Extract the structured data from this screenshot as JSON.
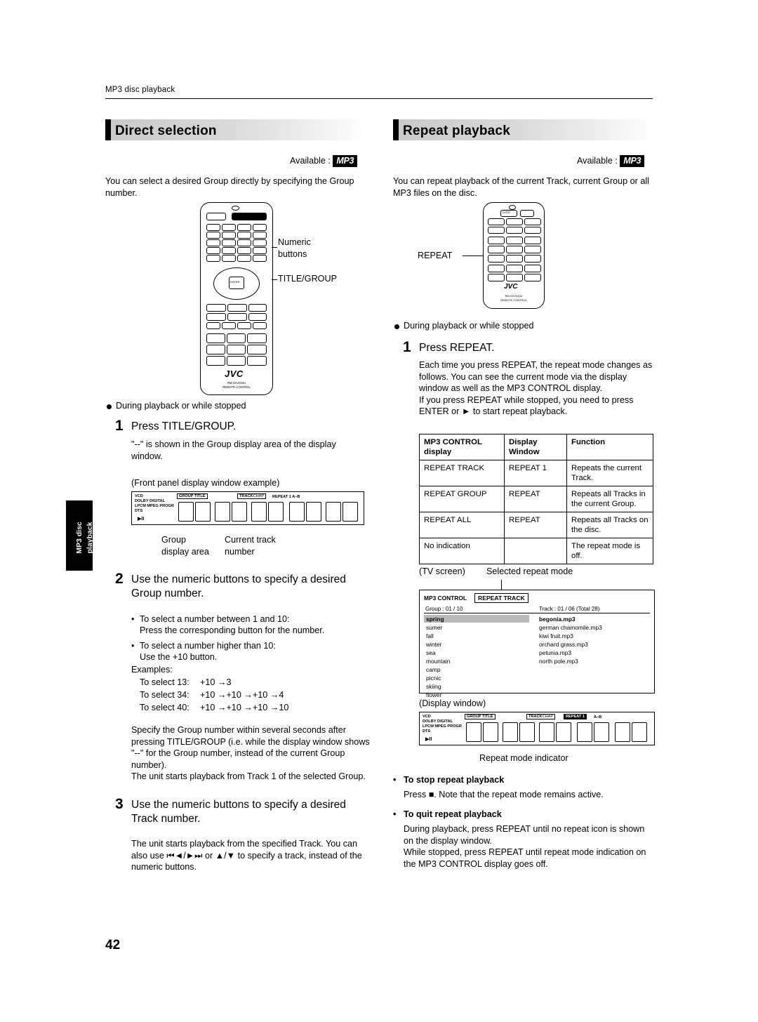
{
  "header": {
    "running_head": "MP3 disc playback"
  },
  "page_number": "42",
  "side_tab": {
    "line1": "MP3 disc",
    "line2": "playback"
  },
  "left": {
    "section_title": "Direct selection",
    "available_label": "Available :",
    "available_badge": "MP3",
    "intro": "You can select a desired Group directly by specifying the Group number.",
    "callouts": {
      "numeric_buttons": "Numeric\nbuttons",
      "title_group": "TITLE/GROUP"
    },
    "bullet_during": "During playback or while stopped",
    "step1_num": "1",
    "step1_text": "Press TITLE/GROUP.",
    "step1_body": "\"--\" is shown in the Group display area of the display window.",
    "front_panel_caption": "(Front panel display window example)",
    "fpd_labels": {
      "vcd": "VCD",
      "cd": "CD",
      "dolby": "DOLBY DIGITAL",
      "lpcm": "LPCM  MPEG  PROGR",
      "dts": "DTS",
      "group_title": "GROUP TITLE",
      "track": "TRACK",
      "chap": "CHAP",
      "repeat": "REPEAT 1 A–B"
    },
    "fpd_caption_left": "Group\ndisplay area",
    "fpd_caption_right": "Current track\nnumber",
    "step2_num": "2",
    "step2_text": "Use the numeric buttons to specify a desired Group number.",
    "step2_bullets": [
      "To select a number between 1 and 10:",
      "To select a number higher than 10:"
    ],
    "step2_sub": [
      "Press the corresponding button for the number.",
      "Use the +10 button."
    ],
    "examples_label": "Examples:",
    "examples": [
      {
        "label": "To select 13:",
        "value": "+10 →3"
      },
      {
        "label": "To select 34:",
        "value": "+10 →+10 →+10 →4"
      },
      {
        "label": "To select 40:",
        "value": "+10 →+10 →+10 →10"
      }
    ],
    "step2_note": "Specify the Group number within several seconds after pressing TITLE/GROUP (i.e. while the display window shows \"--\" for the Group number, instead of the current Group number).\nThe unit starts playback from Track 1 of the selected Group.",
    "step3_num": "3",
    "step3_text": "Use the numeric buttons to specify a desired Track number.",
    "step3_body": "The unit starts playback from the specified Track. You can also use ⏮◄/►⏭ or ▲/▼ to specify a track, instead of the numeric buttons."
  },
  "right": {
    "section_title": "Repeat playback",
    "available_label": "Available :",
    "available_badge": "MP3",
    "intro": "You can repeat playback of the current Track, current Group or all MP3 files on the disc.",
    "callout_repeat": "REPEAT",
    "bullet_during": "During playback or while stopped",
    "step1_num": "1",
    "step1_text": "Press REPEAT.",
    "step1_body": "Each time you press REPEAT, the repeat mode changes as follows. You can see the current mode via the display window as well as the MP3 CONTROL display.\nIf you press REPEAT while stopped, you need to press ENTER or ► to start repeat playback.",
    "table": {
      "headers": [
        "MP3 CONTROL display",
        "Display Window",
        "Function"
      ],
      "rows": [
        [
          "REPEAT TRACK",
          "REPEAT 1",
          "Repeats the current Track."
        ],
        [
          "REPEAT GROUP",
          "REPEAT",
          "Repeats all Tracks in the current Group."
        ],
        [
          "REPEAT ALL",
          "REPEAT",
          "Repeats all Tracks on the disc."
        ],
        [
          "No indication",
          "",
          "The repeat mode is off."
        ]
      ]
    },
    "tv_caption": "(TV screen)",
    "tv_callout": "Selected repeat mode",
    "tv": {
      "title": "MP3 CONTROL",
      "mode_tag": "REPEAT TRACK",
      "group_info": "Group : 01 / 10",
      "track_info": "Track : 01 / 06 (Total 28)",
      "left_list": [
        "spring",
        "sumer",
        "fall",
        "winter",
        "sea",
        "mountain",
        "camp",
        "picnic",
        "skiing",
        "flower"
      ],
      "right_list": [
        "begonia.mp3",
        "german chamomile.mp3",
        "kiwi fruit.mp3",
        "orchard grass.mp3",
        "petunia.mp3",
        "north pole.mp3"
      ]
    },
    "display_window_caption": "(Display window)",
    "fpd_labels": {
      "vcd": "VCD",
      "cd": "CD",
      "dolby": "DOLBY DIGITAL",
      "lpcm": "LPCM  MPEG  PROGR",
      "dts": "DTS",
      "group_title": "GROUP TITLE",
      "track": "TRACK",
      "chap": "CHAP",
      "repeat": "REPEAT 1 A–B"
    },
    "repeat_indicator_caption": "Repeat mode indicator",
    "stop_heading": "To stop repeat playback",
    "stop_body": "Press ■. Note that the repeat mode remains active.",
    "quit_heading": "To quit repeat playback",
    "quit_body": "During playback, press REPEAT until no repeat icon is shown on the display window.\nWhile stopped, press REPEAT until repeat mode indication on the MP3 CONTROL display goes off."
  },
  "remote": {
    "brand": "JVC",
    "model": "RM-SXV010U",
    "sub": "REMOTE CONTROL"
  }
}
